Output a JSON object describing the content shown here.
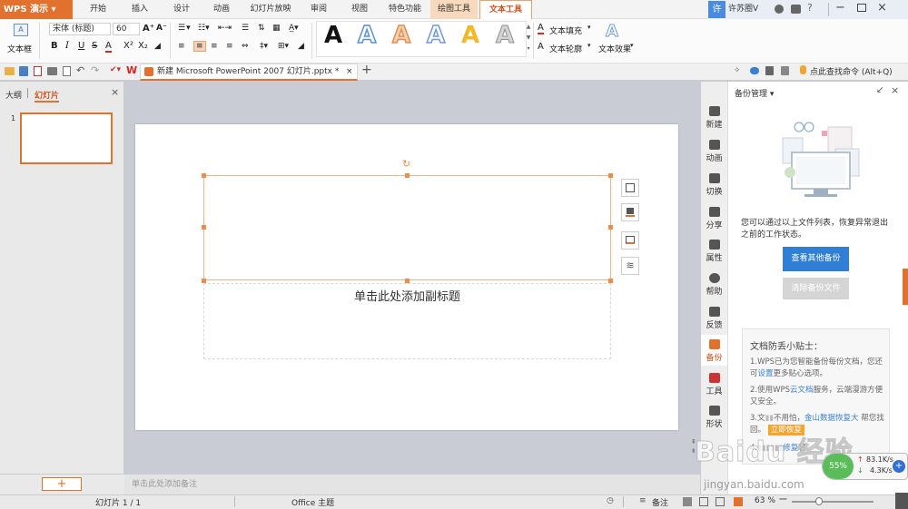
{
  "app": {
    "logo": "WPS 演示"
  },
  "menu": {
    "items": [
      "开始",
      "插入",
      "设计",
      "动画",
      "幻灯片放映",
      "审阅",
      "视图",
      "特色功能",
      "绘图工具",
      "文本工具"
    ],
    "active": "文本工具"
  },
  "user": {
    "avatar_char": "许",
    "name": "许苏圈V"
  },
  "ribbon": {
    "textbox_label": "文本框",
    "font_name": "宋体 (标题)",
    "font_size": "60",
    "bold": "B",
    "italic": "I",
    "underline": "U",
    "strike": "S",
    "font_color": "A",
    "superscript": "X²",
    "subscript": "X₂",
    "text_fill": "文本填充",
    "text_outline": "文本轮廓",
    "text_effect": "文本效果",
    "wordart_glyph": "A",
    "wordart_colors": [
      "#111111",
      "#5b8fd6",
      "#e8894a",
      "#6f9ad8",
      "#f4b72a",
      "#8f8f8f"
    ]
  },
  "quickbar": {
    "doc_title": "新建 Microsoft PowerPoint 2007 幻灯片.pptx *",
    "close": "×",
    "new_tab": "+",
    "search": "点此查找命令 (Alt+Q)"
  },
  "leftpane": {
    "tab_outline": "大纲",
    "tab_slides": "幻灯片",
    "close": "×",
    "slide_number": "1",
    "add": "+"
  },
  "slide": {
    "subtitle_placeholder": "单击此处添加副标题"
  },
  "notes": {
    "placeholder": "单击此处添加备注"
  },
  "status": {
    "slide_info": "幻灯片 1 / 1",
    "theme": "Office 主题",
    "notes_label": "备注",
    "zoom": "63 %"
  },
  "rtools": [
    "新建",
    "动画",
    "切换",
    "分享",
    "属性",
    "帮助",
    "反馈",
    "备份",
    "工具",
    "形状"
  ],
  "panel": {
    "title": "备份管理",
    "description": "您可以通过以上文件列表，恢复异常退出之前的工作状态。",
    "view_btn": "查看其他备份",
    "clear_btn": "清除备份文件",
    "tips_title": "文档防丢小贴士：",
    "tip1_a": "1.WPS已为您智能备份每份文档，您还可",
    "tip1_link": "设置",
    "tip1_b": "更多贴心选项。",
    "tip2_a": "2.使用WPS",
    "tip2_link": "云文档",
    "tip2_b": "服务，云端漫游方便又安全。",
    "tip3_a": "3.文",
    "tip3_mid": "不用怕，",
    "tip3_link": "金山数据恢复大",
    "tip3_b": "帮您找回。",
    "tip3_btn": "立即恢复",
    "tip4_a": "4.",
    "tip4_link": "修复",
    "tip4_b": "轻"
  },
  "netmon": {
    "percent": "55%",
    "up": "83.1K/s",
    "down": "4.3K/s"
  },
  "watermark": {
    "line1": "Baidu 经验",
    "line2": "jingyan.baidu.com"
  },
  "colors": {
    "accent": "#e3712e",
    "primary_btn": "#2f7fd6",
    "disabled_btn": "#cfcfcf"
  }
}
